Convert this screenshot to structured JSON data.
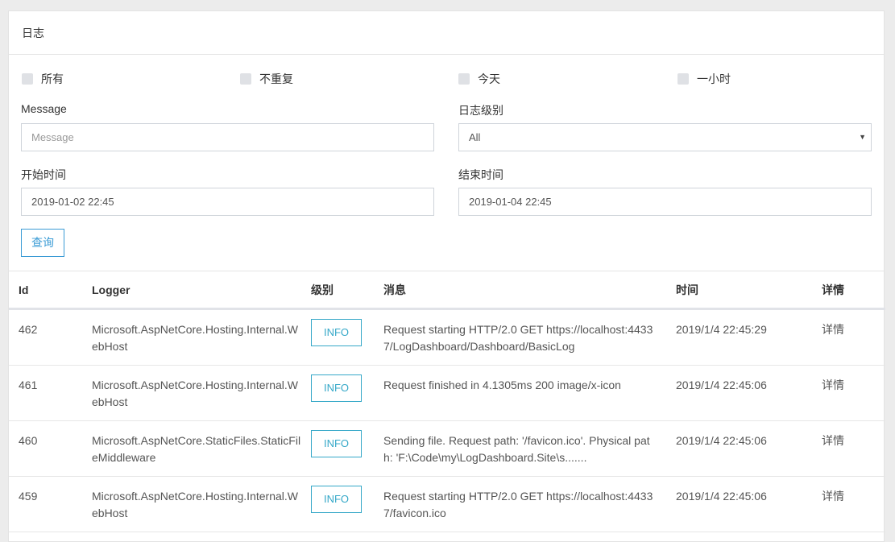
{
  "panel": {
    "title": "日志"
  },
  "filters": {
    "checkboxes": [
      {
        "label": "所有",
        "checked": false
      },
      {
        "label": "不重复",
        "checked": false
      },
      {
        "label": "今天",
        "checked": false
      },
      {
        "label": "一小时",
        "checked": false
      }
    ],
    "message": {
      "label": "Message",
      "placeholder": "Message",
      "value": ""
    },
    "level": {
      "label": "日志级别",
      "value": "All"
    },
    "start": {
      "label": "开始时间",
      "value": "2019-01-02 22:45"
    },
    "end": {
      "label": "结束时间",
      "value": "2019-01-04 22:45"
    },
    "query_label": "查询"
  },
  "table": {
    "headers": [
      "Id",
      "Logger",
      "级别",
      "消息",
      "时间",
      "详情"
    ],
    "rows": [
      {
        "id": "462",
        "logger": "Microsoft.AspNetCore.Hosting.Internal.WebHost",
        "level": "INFO",
        "message": "Request starting HTTP/2.0 GET https://localhost:44337/LogDashboard/Dashboard/BasicLog",
        "time": "2019/1/4 22:45:29",
        "detail": "详情"
      },
      {
        "id": "461",
        "logger": "Microsoft.AspNetCore.Hosting.Internal.WebHost",
        "level": "INFO",
        "message": "Request finished in 4.1305ms 200 image/x-icon",
        "time": "2019/1/4 22:45:06",
        "detail": "详情"
      },
      {
        "id": "460",
        "logger": "Microsoft.AspNetCore.StaticFiles.StaticFileMiddleware",
        "level": "INFO",
        "message": "Sending file. Request path: '/favicon.ico'. Physical path: 'F:\\Code\\my\\LogDashboard.Site\\s.......",
        "time": "2019/1/4 22:45:06",
        "detail": "详情"
      },
      {
        "id": "459",
        "logger": "Microsoft.AspNetCore.Hosting.Internal.WebHost",
        "level": "INFO",
        "message": "Request starting HTTP/2.0 GET https://localhost:44337/favicon.ico",
        "time": "2019/1/4 22:45:06",
        "detail": "详情"
      }
    ]
  }
}
